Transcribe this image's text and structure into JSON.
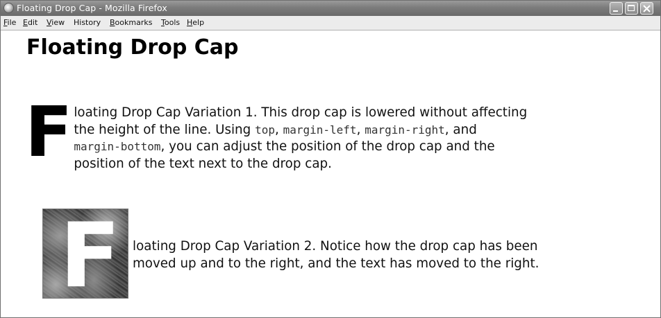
{
  "window": {
    "title": "Floating Drop Cap - Mozilla Firefox"
  },
  "menubar": {
    "items": [
      {
        "mnemonic": "F",
        "rest": "ile"
      },
      {
        "mnemonic": "E",
        "rest": "dit"
      },
      {
        "mnemonic": "V",
        "rest": "iew"
      },
      {
        "mnemonic": "",
        "rest": "History"
      },
      {
        "mnemonic": "B",
        "rest": "ookmarks"
      },
      {
        "mnemonic": "T",
        "rest": "ools"
      },
      {
        "mnemonic": "H",
        "rest": "elp"
      }
    ]
  },
  "page": {
    "heading": "Floating Drop Cap",
    "variation1": {
      "drop_cap": "F",
      "text_a": "loating Drop Cap Variation 1. This drop cap is lowered without affecting",
      "text_b": "the height of the line. Using ",
      "code_top": "top",
      "sep1": ", ",
      "code_margin_left": "margin-left",
      "sep2": ", ",
      "code_margin_right": "margin-right",
      "sep3": ", and",
      "code_margin_bottom": "margin-bottom",
      "text_c": ", you can adjust the position of the drop cap and the",
      "text_d": "position of the text next to the drop cap."
    },
    "variation2": {
      "drop_cap": "F",
      "text_a": "loating Drop Cap Variation 2. Notice how the drop cap has been",
      "text_b": "moved up and to the right, and the text has moved to the right."
    }
  }
}
